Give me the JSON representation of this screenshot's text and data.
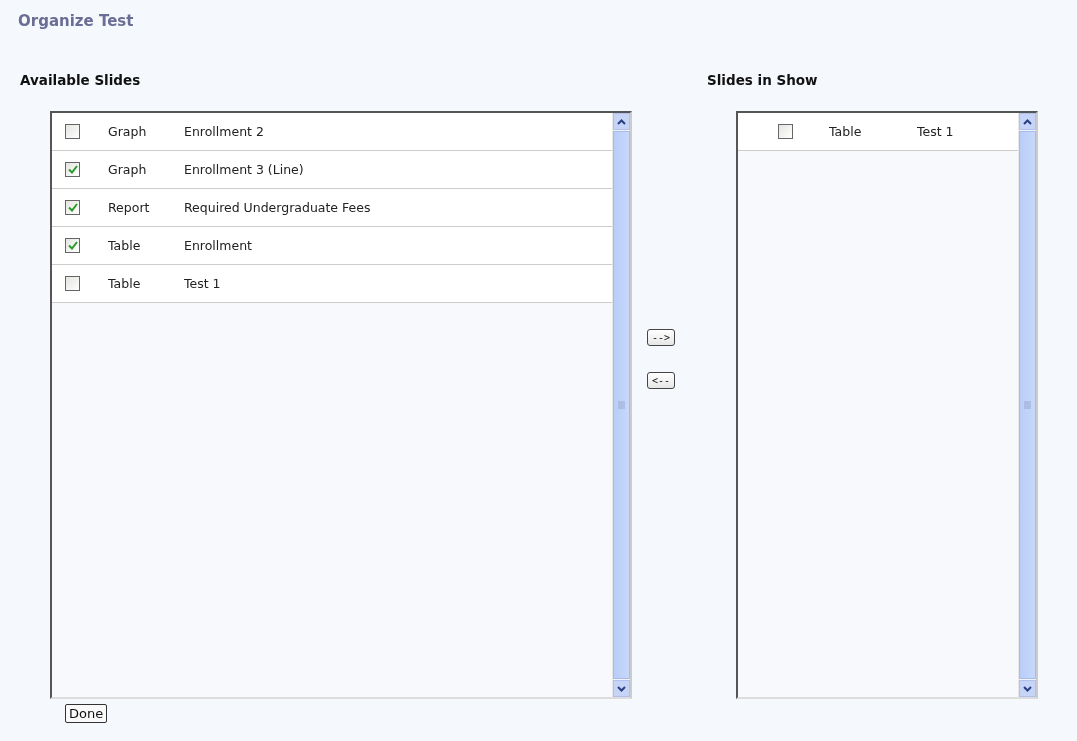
{
  "title": "Organize Test",
  "available": {
    "heading": "Available Slides",
    "rows": [
      {
        "checked": false,
        "type": "Graph",
        "name": "Enrollment 2"
      },
      {
        "checked": true,
        "type": "Graph",
        "name": "Enrollment 3 (Line)"
      },
      {
        "checked": true,
        "type": "Report",
        "name": "Required Undergraduate Fees"
      },
      {
        "checked": true,
        "type": "Table",
        "name": "Enrollment"
      },
      {
        "checked": false,
        "type": "Table",
        "name": "Test 1"
      }
    ]
  },
  "move_buttons": [
    "-->",
    "<--"
  ],
  "in_show": {
    "heading": "Slides in Show",
    "rows": [
      {
        "checked": false,
        "type": "Table",
        "name": "Test 1"
      }
    ]
  },
  "done_button": "Done"
}
